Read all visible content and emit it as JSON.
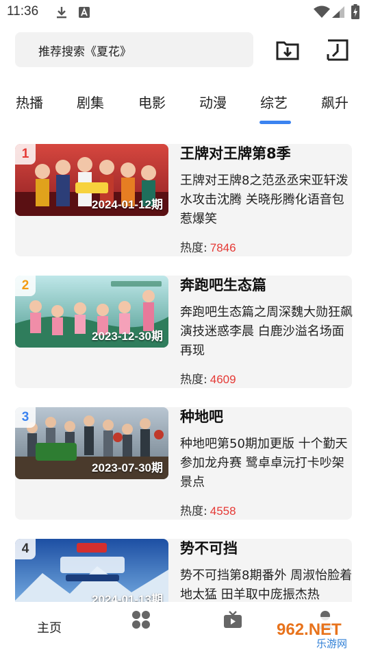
{
  "status_bar": {
    "time": "11:36",
    "icons": [
      "download-icon",
      "notification-a-icon",
      "wifi-icon",
      "signal-icon",
      "battery-icon"
    ]
  },
  "search": {
    "placeholder": "推荐搜索《夏花》"
  },
  "toolbar": {
    "icons": [
      "download-folder-icon",
      "history-icon"
    ]
  },
  "tabs": [
    {
      "label": "热播"
    },
    {
      "label": "剧集"
    },
    {
      "label": "电影"
    },
    {
      "label": "动漫"
    },
    {
      "label": "综艺",
      "active": true
    },
    {
      "label": "飙升"
    }
  ],
  "accent_color": "#3b83f0",
  "heat_color": "#e53935",
  "list": {
    "heat_label": "热度:",
    "items": [
      {
        "rank": "1",
        "rank_color": "#e53935",
        "episode": "2024-01-12期",
        "title": "王牌对王牌第8季",
        "description": "王牌对王牌8之范丞丞宋亚轩泼水攻击沈腾 关晓彤腾化语音包惹爆笑",
        "heat": "7846"
      },
      {
        "rank": "2",
        "rank_color": "#f39c12",
        "episode": "2023-12-30期",
        "title": "奔跑吧生态篇",
        "description": "奔跑吧生态篇之周深魏大勋狂飙演技迷惑李晨 白鹿沙溢名场面再现",
        "heat": "4609"
      },
      {
        "rank": "3",
        "rank_color": "#3b83f0",
        "episode": "2023-07-30期",
        "title": "种地吧",
        "description": "种地吧第50期加更版 十个勤天参加龙舟赛 鹭卓卓沅打卡吵架景点",
        "heat": "4558"
      },
      {
        "rank": "4",
        "rank_color": "#333333",
        "episode": "2024-01-13期",
        "title": "势不可挡",
        "description": "势不可挡第8期番外 周淑怡脸着地太猛 田羊取中庞振杰热",
        "heat": ""
      }
    ]
  },
  "bottom_nav": {
    "home_label": "主页",
    "icons": [
      "category-grid-icon",
      "tv-icon",
      "profile-icon"
    ]
  },
  "watermark": {
    "text_top": "962.NET",
    "text_bottom": "乐游网"
  }
}
